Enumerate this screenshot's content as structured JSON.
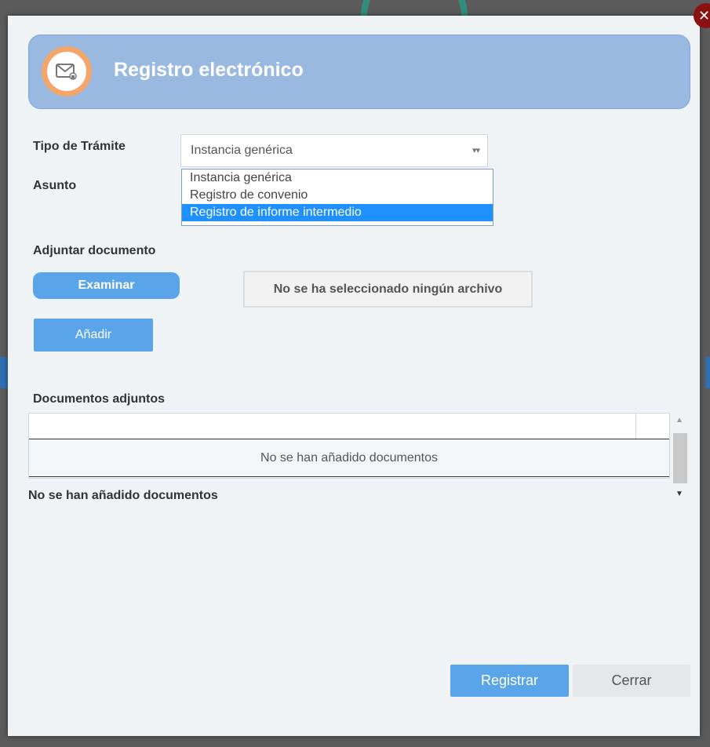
{
  "dialog": {
    "title": "Registro electrónico",
    "close_icon": "close-icon",
    "logo_icon": "envelope-icon"
  },
  "form": {
    "tipo_label": "Tipo de Trámite",
    "tipo_value": "Instancia genérica",
    "tipo_arrow": "▾▾",
    "tipo_options": [
      "Instancia genérica",
      "Registro de convenio",
      "Registro de informe intermedio"
    ],
    "tipo_highlighted": "Registro de informe intermedio",
    "asunto_label": "Asunto",
    "adjuntar_label": "Adjuntar documento",
    "examinar_label": "Examinar",
    "file_status": "No se ha seleccionado ningún archivo",
    "anadir_label": "Añadir"
  },
  "documents": {
    "heading": "Documentos adjuntos",
    "empty_row": "No se han añadido documentos",
    "footer": "No se han añadido documentos"
  },
  "actions": {
    "registrar_label": "Registrar",
    "cerrar_label": "Cerrar"
  },
  "colors": {
    "header_bg": "#9ab9e0",
    "accent_button": "#5aa5ea",
    "highlight_option": "#1e90ff",
    "logo_ring": "#f3a56a",
    "close_button": "#8b1010"
  }
}
